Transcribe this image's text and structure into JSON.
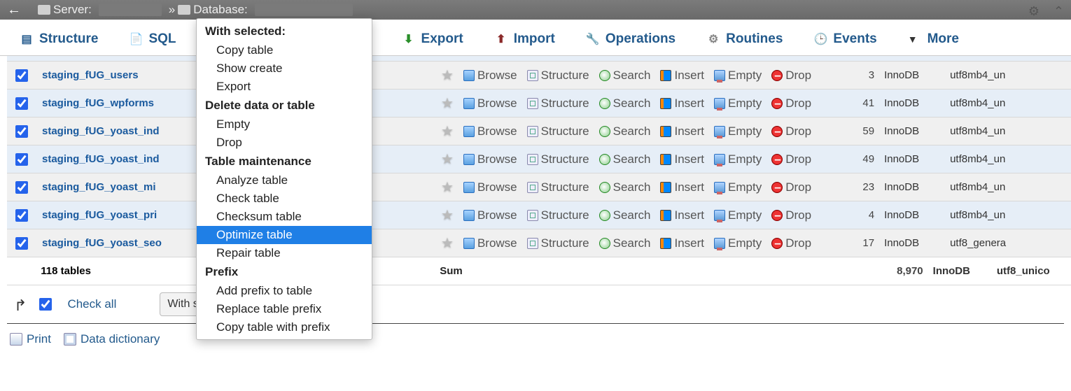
{
  "breadcrumb": {
    "server_label": "Server:",
    "database_label": "Database:"
  },
  "tabs": {
    "structure": "Structure",
    "sql": "SQL",
    "export": "Export",
    "import": "Import",
    "operations": "Operations",
    "routines": "Routines",
    "events": "Events",
    "more": "More"
  },
  "actions": {
    "browse": "Browse",
    "structure": "Structure",
    "search": "Search",
    "insert": "Insert",
    "empty": "Empty",
    "drop": "Drop"
  },
  "rows": [
    {
      "name": "staging_fUG_users",
      "count": "3",
      "engine": "InnoDB",
      "collation": "utf8mb4_un"
    },
    {
      "name": "staging_fUG_wpforms",
      "count": "41",
      "engine": "InnoDB",
      "collation": "utf8mb4_un"
    },
    {
      "name": "staging_fUG_yoast_ind",
      "count": "59",
      "engine": "InnoDB",
      "collation": "utf8mb4_un"
    },
    {
      "name": "staging_fUG_yoast_ind",
      "count": "49",
      "engine": "InnoDB",
      "collation": "utf8mb4_un"
    },
    {
      "name": "staging_fUG_yoast_mi",
      "count": "23",
      "engine": "InnoDB",
      "collation": "utf8mb4_un"
    },
    {
      "name": "staging_fUG_yoast_pri",
      "count": "4",
      "engine": "InnoDB",
      "collation": "utf8mb4_un"
    },
    {
      "name": "staging_fUG_yoast_seo",
      "count": "17",
      "engine": "InnoDB",
      "collation": "utf8_genera"
    }
  ],
  "summary": {
    "label": "118 tables",
    "sum_label": "Sum",
    "total": "8,970",
    "engine": "InnoDB",
    "collation": "utf8_unico"
  },
  "footer": {
    "check_all": "Check all",
    "with_selected": "With selected:"
  },
  "bottom": {
    "print": "Print",
    "data_dictionary": "Data dictionary"
  },
  "context_menu": {
    "h1": "With selected:",
    "copy_table": "Copy table",
    "show_create": "Show create",
    "export": "Export",
    "h2": "Delete data or table",
    "empty": "Empty",
    "drop": "Drop",
    "h3": "Table maintenance",
    "analyze": "Analyze table",
    "check": "Check table",
    "checksum": "Checksum table",
    "optimize": "Optimize table",
    "repair": "Repair table",
    "h4": "Prefix",
    "add_prefix": "Add prefix to table",
    "replace_prefix": "Replace table prefix",
    "copy_prefix": "Copy table with prefix"
  }
}
